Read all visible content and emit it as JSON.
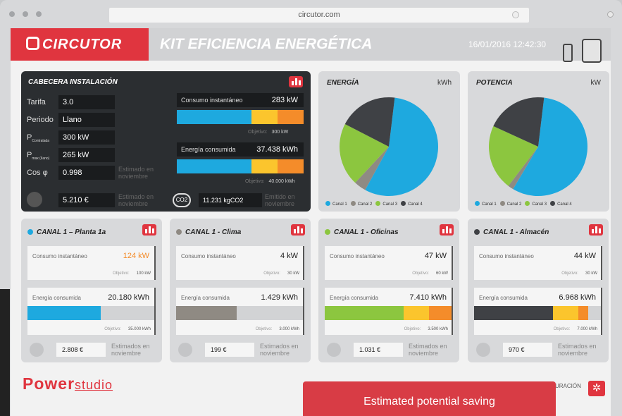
{
  "browser": {
    "url": "circutor.com"
  },
  "header": {
    "brand": "CIRCUTOR",
    "title": "KIT EFICIENCIA ENERGÉTICA",
    "datetime": "16/01/2016  12:42:30"
  },
  "cabecera": {
    "title": "CABECERA INSTALACIÓN",
    "fields": [
      {
        "label": "Tarifa",
        "value": "3.0"
      },
      {
        "label": "Periodo",
        "value": "Llano"
      },
      {
        "label": "P",
        "sub": "Contratada",
        "value": "300 kW"
      },
      {
        "label": "P",
        "sub": "max (Ilano)",
        "value": "265 kW"
      },
      {
        "label": "Cos φ",
        "value": "0.998"
      }
    ],
    "est_label": "Estimado en noviembre",
    "cost": "5.210 €",
    "cost_label": "Estimado en noviembre",
    "consumo_label": "Consumo instantáneo",
    "consumo_value": "283 kW",
    "consumo_obj": "Objetivo:",
    "consumo_obj_val": "300 kW",
    "energia_label": "Energía consumida",
    "energia_value": "37.438 kWh",
    "energia_obj": "Objetivo:",
    "energia_obj_val": "40.000 kWh",
    "co2_icon": "CO2",
    "co2_value": "11.231 kgCO2",
    "co2_label": "Emitido en noviembre"
  },
  "pies": [
    {
      "title": "ENERGÍA",
      "unit": "kWh"
    },
    {
      "title": "POTENCIA",
      "unit": "kW"
    }
  ],
  "legend": [
    "Canal 1",
    "Canal 2",
    "Canal 3",
    "Canal 4"
  ],
  "colors": {
    "c1": "#1ea9df",
    "c2": "#8f8a83",
    "c3": "#8cc63f",
    "c4": "#3f4145",
    "red": "#e0353f",
    "yellow": "#fbc52d",
    "orange": "#f48c2a"
  },
  "chart_data": [
    {
      "type": "pie",
      "title": "ENERGÍA",
      "categories": [
        "Canal 1",
        "Canal 2",
        "Canal 3",
        "Canal 4"
      ],
      "values": [
        20180,
        1429,
        7410,
        6968
      ]
    },
    {
      "type": "pie",
      "title": "POTENCIA",
      "categories": [
        "Canal 1",
        "Canal 2",
        "Canal 3",
        "Canal 4"
      ],
      "values": [
        124,
        4,
        47,
        44
      ]
    }
  ],
  "channels": [
    {
      "title": "CANAL 1 – Planta 1a",
      "color": "#1ea9df",
      "consumo_label": "Consumo instantáneo",
      "consumo": "124 kW",
      "obj": "Objetivo:",
      "obj_val": "100 kW",
      "energia_label": "Energía consumida",
      "energia": "20.180 kWh",
      "e_obj": "Objetivo:",
      "e_obj_val": "35.000 kWh",
      "cost": "2.808 €",
      "est": "Estimados en noviembre",
      "fill": 0.58
    },
    {
      "title": "CANAL 1 - Clima",
      "color": "#8f8a83",
      "consumo_label": "Consumo instantáneo",
      "consumo": "4 kW",
      "obj": "Objetivo:",
      "obj_val": "30 kW",
      "energia_label": "Energía consumida",
      "energia": "1.429 kWh",
      "e_obj": "Objetivo:",
      "e_obj_val": "3.000 kWh",
      "cost": "199 €",
      "est": "Estimados en noviembre",
      "fill": 0.48
    },
    {
      "title": "CANAL 1 - Oficinas",
      "color": "#8cc63f",
      "consumo_label": "Consumo instantáneo",
      "consumo": "47 kW",
      "obj": "Objetivo:",
      "obj_val": "60 kW",
      "energia_label": "Energía consumida",
      "energia": "7.410 kWh",
      "e_obj": "Objetivo:",
      "e_obj_val": "3.500 kWh",
      "cost": "1.031 €",
      "est": "Estimados en noviembre",
      "fill": 1.0
    },
    {
      "title": "CANAL 1 - Almacén",
      "color": "#3f4145",
      "consumo_label": "Consumo instantáneo",
      "consumo": "44 kW",
      "obj": "Objetivo:",
      "obj_val": "30 kW",
      "energia_label": "Energía consumida",
      "energia": "6.968 kWh",
      "e_obj": "Objetivo:",
      "e_obj_val": "7.000 kWh",
      "cost": "970 €",
      "est": "Estimados en noviembre",
      "fill": 0.9
    }
  ],
  "footer": {
    "brand": "Power",
    "brand_sub": "studio",
    "config": "URACIÓN",
    "saving": "Estimated potential saving"
  }
}
